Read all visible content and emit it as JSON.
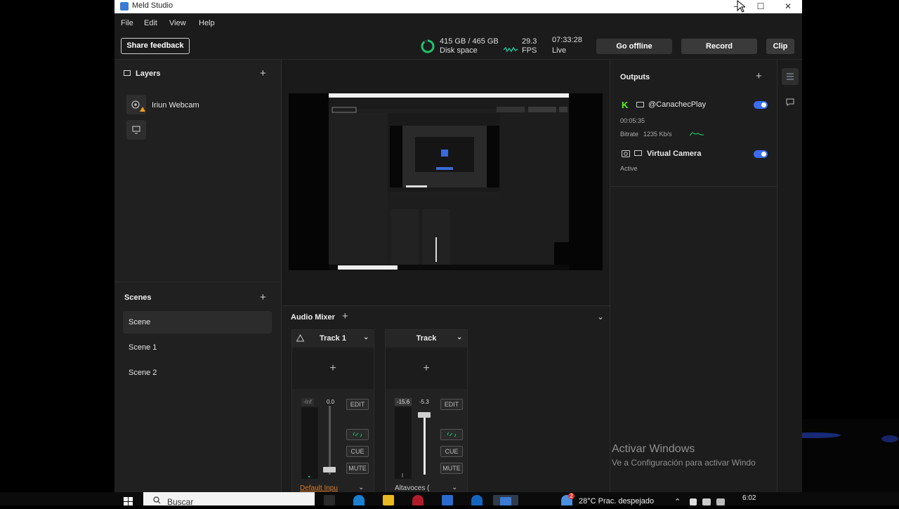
{
  "window": {
    "title": "Meld Studio",
    "controls": {
      "minimize": "─",
      "maximize": "☐",
      "close": "✕"
    }
  },
  "menu": [
    "File",
    "Edit",
    "View",
    "Help"
  ],
  "toolbar": {
    "feedback": "Share feedback",
    "disk_value": "415 GB / 465 GB",
    "disk_label": "Disk space",
    "fps_value": "29.3",
    "fps_label": "FPS",
    "time": "07:33:28",
    "status": "Live",
    "go_offline": "Go offline",
    "record": "Record",
    "clip": "Clip",
    "disk_used_fraction": 0.89
  },
  "layers": {
    "title": "Layers",
    "add": "+",
    "items": [
      {
        "label": "Iriun Webcam",
        "icon": "webcam-warning-icon"
      },
      {
        "label": "",
        "icon": "monitor-icon"
      }
    ]
  },
  "scenes": {
    "title": "Scenes",
    "add": "+",
    "items": [
      "Scene",
      "Scene 1",
      "Scene 2"
    ],
    "selected": 0
  },
  "mixer": {
    "title": "Audio Mixer",
    "add": "+",
    "collapse": "⌄",
    "tracks": [
      {
        "name": "Track 1",
        "add": "+",
        "peak": "-Inf",
        "gain": "0.0",
        "edit": "EDIT",
        "cue": "CUE",
        "mute": "MUTE",
        "input": "Default Inpu",
        "level": 0.02
      },
      {
        "name": "Track",
        "add": "+",
        "peak": "-15.6",
        "gain": "-5.3",
        "edit": "EDIT",
        "cue": "CUE",
        "mute": "MUTE",
        "input": "Altavoces (",
        "level": 0.8
      }
    ],
    "scale": [
      "0",
      "-6",
      "-12",
      "-18",
      "-24",
      "-30",
      "-36",
      "-42",
      "-48",
      "-54"
    ]
  },
  "outputs": {
    "title": "Outputs",
    "add": "+",
    "stream": {
      "name": "@CanachecPlay",
      "duration": "00:05:35",
      "bitrate_label": "Bitrate",
      "bitrate_value": "1235 Kb/s",
      "enabled": true,
      "brand_color": "#53fc18"
    },
    "virtual": {
      "name": "Virtual Camera",
      "status": "Active",
      "enabled": true
    }
  },
  "desktop": {
    "watermark_title": "Activar Windows",
    "watermark_sub": "Ve a Configuración para activar Windo"
  },
  "taskbar": {
    "search": "Buscar",
    "weather": "28°C  Prac. despejado",
    "weather_badge": "2",
    "time": "6:02"
  },
  "colors": {
    "accent": "#3b6cf0",
    "disk_ring": "#21c06a",
    "fps_wave": "#21c0a0"
  }
}
